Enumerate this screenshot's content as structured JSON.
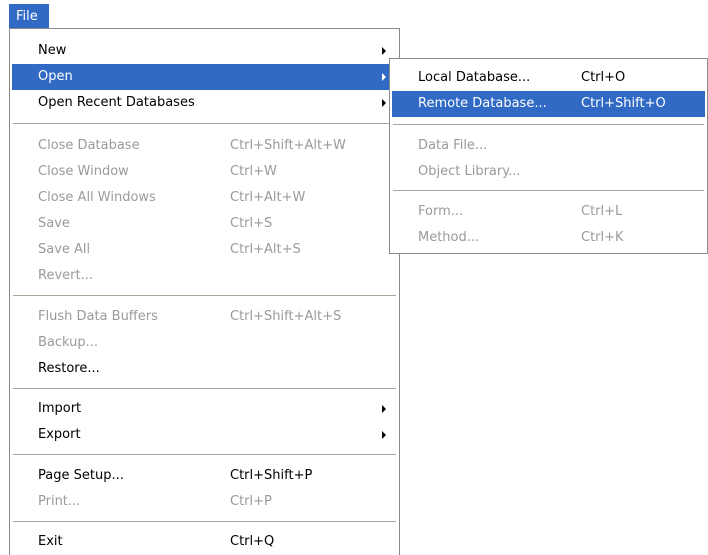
{
  "menubar": {
    "file_label": "File"
  },
  "menu": {
    "new": {
      "label": "New"
    },
    "open": {
      "label": "Open"
    },
    "open_recent": {
      "label": "Open Recent Databases"
    },
    "close_database": {
      "label": "Close Database",
      "shortcut": "Ctrl+Shift+Alt+W"
    },
    "close_window": {
      "label": "Close Window",
      "shortcut": "Ctrl+W"
    },
    "close_all_windows": {
      "label": "Close All Windows",
      "shortcut": "Ctrl+Alt+W"
    },
    "save": {
      "label": "Save",
      "shortcut": "Ctrl+S"
    },
    "save_all": {
      "label": "Save All",
      "shortcut": "Ctrl+Alt+S"
    },
    "revert": {
      "label": "Revert..."
    },
    "flush_data_buffers": {
      "label": "Flush Data Buffers",
      "shortcut": "Ctrl+Shift+Alt+S"
    },
    "backup": {
      "label": "Backup..."
    },
    "restore": {
      "label": "Restore..."
    },
    "import": {
      "label": "Import"
    },
    "export": {
      "label": "Export"
    },
    "page_setup": {
      "label": "Page Setup...",
      "shortcut": "Ctrl+Shift+P"
    },
    "print": {
      "label": "Print...",
      "shortcut": "Ctrl+P"
    },
    "exit": {
      "label": "Exit",
      "shortcut": "Ctrl+Q"
    }
  },
  "submenu": {
    "local_database": {
      "label": "Local Database...",
      "shortcut": "Ctrl+O"
    },
    "remote_database": {
      "label": "Remote Database...",
      "shortcut": "Ctrl+Shift+O"
    },
    "data_file": {
      "label": "Data File..."
    },
    "object_library": {
      "label": "Object Library..."
    },
    "form": {
      "label": "Form...",
      "shortcut": "Ctrl+L"
    },
    "method": {
      "label": "Method...",
      "shortcut": "Ctrl+K"
    }
  },
  "colors": {
    "highlight": "#316ac5",
    "disabled_text": "#9a9a9a",
    "separator": "#aca899"
  }
}
